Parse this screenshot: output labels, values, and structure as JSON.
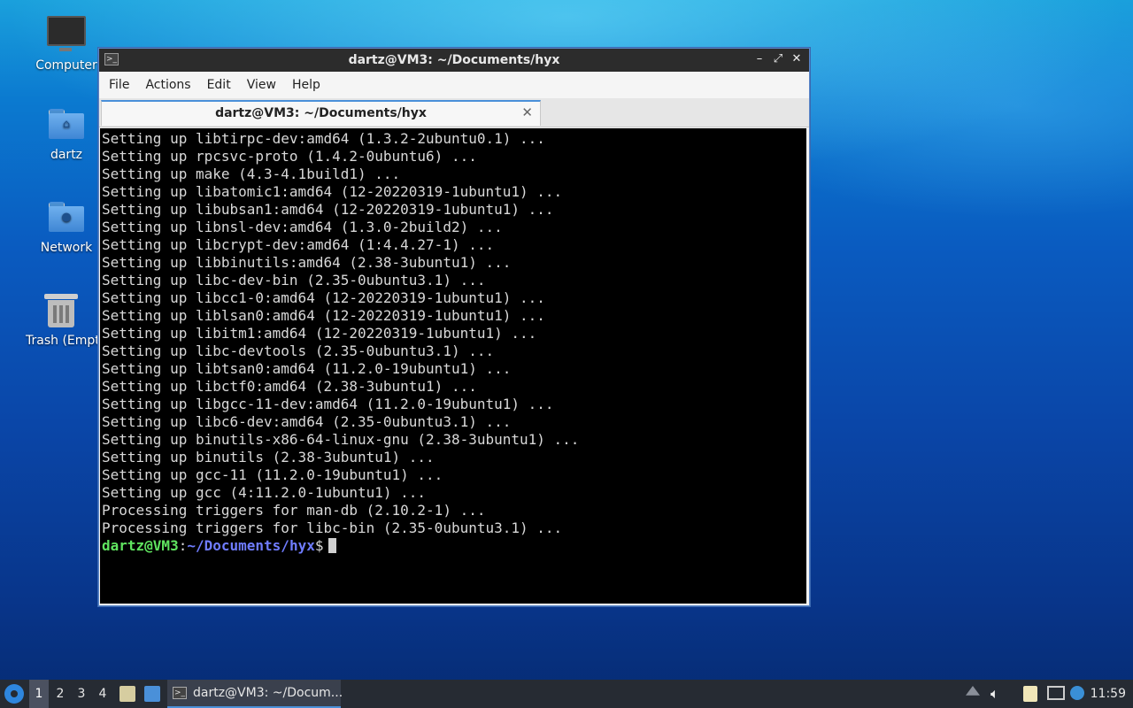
{
  "desktop": {
    "icons": [
      {
        "label": "Computer",
        "icon": "computer-icon"
      },
      {
        "label": "dartz",
        "icon": "home-folder-icon"
      },
      {
        "label": "Network",
        "icon": "network-folder-icon"
      },
      {
        "label": "Trash (Empty)",
        "icon": "trash-icon"
      }
    ]
  },
  "window": {
    "title": "dartz@VM3: ~/Documents/hyx",
    "menu": [
      "File",
      "Actions",
      "Edit",
      "View",
      "Help"
    ],
    "tab_title": "dartz@VM3: ~/Documents/hyx",
    "controls": {
      "minimize": "–",
      "maximize": "⤢",
      "close": "✕"
    }
  },
  "terminal": {
    "lines": [
      "Setting up libtirpc-dev:amd64 (1.3.2-2ubuntu0.1) ...",
      "Setting up rpcsvc-proto (1.4.2-0ubuntu6) ...",
      "Setting up make (4.3-4.1build1) ...",
      "Setting up libatomic1:amd64 (12-20220319-1ubuntu1) ...",
      "Setting up libubsan1:amd64 (12-20220319-1ubuntu1) ...",
      "Setting up libnsl-dev:amd64 (1.3.0-2build2) ...",
      "Setting up libcrypt-dev:amd64 (1:4.4.27-1) ...",
      "Setting up libbinutils:amd64 (2.38-3ubuntu1) ...",
      "Setting up libc-dev-bin (2.35-0ubuntu3.1) ...",
      "Setting up libcc1-0:amd64 (12-20220319-1ubuntu1) ...",
      "Setting up liblsan0:amd64 (12-20220319-1ubuntu1) ...",
      "Setting up libitm1:amd64 (12-20220319-1ubuntu1) ...",
      "Setting up libc-devtools (2.35-0ubuntu3.1) ...",
      "Setting up libtsan0:amd64 (11.2.0-19ubuntu1) ...",
      "Setting up libctf0:amd64 (2.38-3ubuntu1) ...",
      "Setting up libgcc-11-dev:amd64 (11.2.0-19ubuntu1) ...",
      "Setting up libc6-dev:amd64 (2.35-0ubuntu3.1) ...",
      "Setting up binutils-x86-64-linux-gnu (2.38-3ubuntu1) ...",
      "Setting up binutils (2.38-3ubuntu1) ...",
      "Setting up gcc-11 (11.2.0-19ubuntu1) ...",
      "Setting up gcc (4:11.2.0-1ubuntu1) ...",
      "Processing triggers for man-db (2.10.2-1) ...",
      "Processing triggers for libc-bin (2.35-0ubuntu3.1) ..."
    ],
    "prompt_user": "dartz@VM3",
    "prompt_sep": ":",
    "prompt_path": "~/Documents/hyx",
    "prompt_end": "$"
  },
  "taskbar": {
    "workspaces": [
      "1",
      "2",
      "3",
      "4"
    ],
    "active_workspace": "1",
    "task_label": "dartz@VM3: ~/Docum...",
    "clock": "11:59"
  },
  "colors": {
    "prompt_user": "#5fe35f",
    "prompt_path": "#6f7cff",
    "accent": "#4a90d9"
  }
}
